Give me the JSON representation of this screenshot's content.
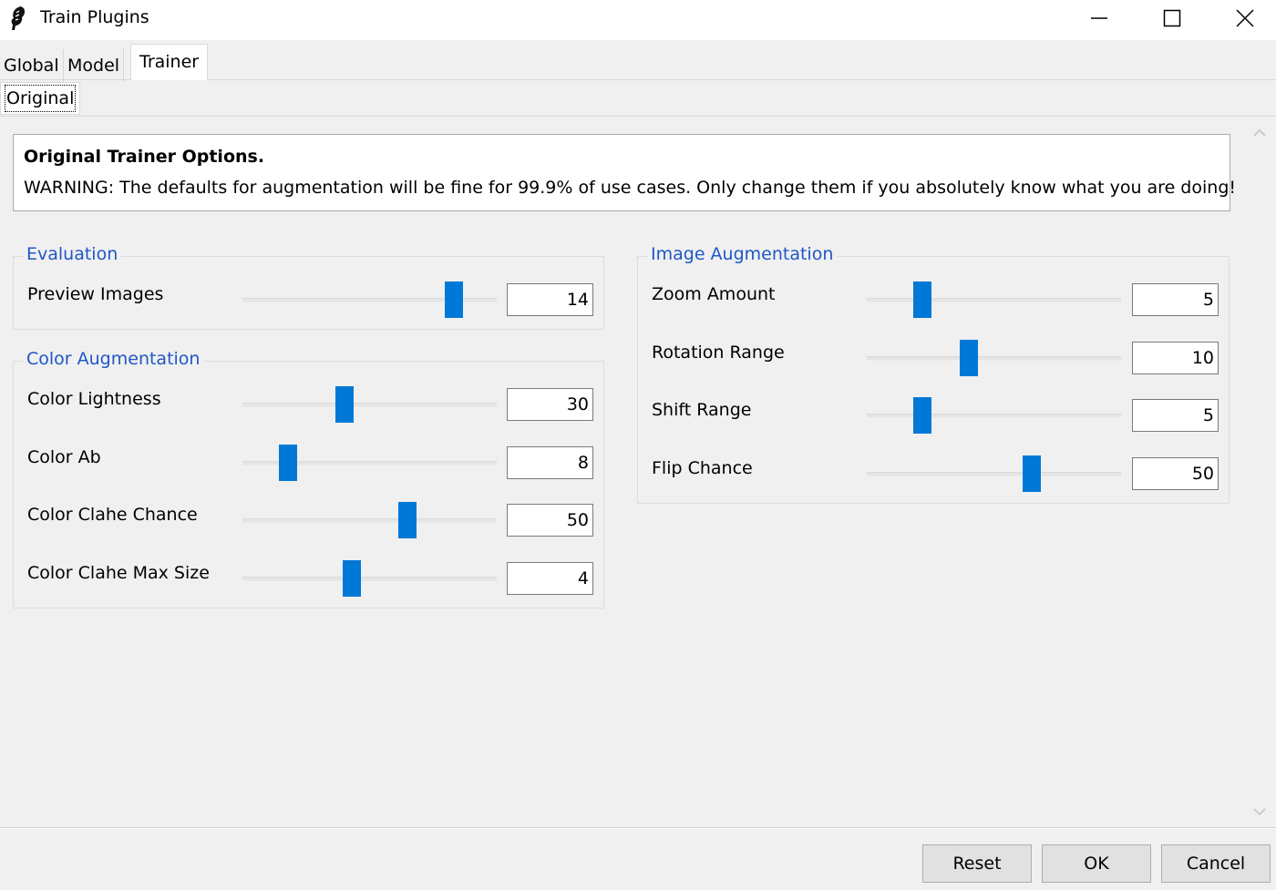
{
  "window": {
    "title": "Train Plugins",
    "icon": "feather-icon"
  },
  "tabs": [
    {
      "label": "Global",
      "active": false
    },
    {
      "label": "Model",
      "active": false
    },
    {
      "label": "Trainer",
      "active": true
    }
  ],
  "subtabs": [
    {
      "label": "Original",
      "active": true
    }
  ],
  "info": {
    "title": "Original Trainer Options.",
    "text": "WARNING: The defaults for augmentation will be fine for 99.9% of use cases. Only change them if you absolutely know what you are doing!"
  },
  "groups": {
    "evaluation": {
      "title": "Evaluation",
      "options": [
        {
          "label": "Preview Images",
          "value": "14",
          "slider_fraction": 0.83
        }
      ]
    },
    "color_augmentation": {
      "title": "Color Augmentation",
      "options": [
        {
          "label": "Color Lightness",
          "value": "30",
          "slider_fraction": 0.4
        },
        {
          "label": "Color Ab",
          "value": "8",
          "slider_fraction": 0.18
        },
        {
          "label": "Color Clahe Chance",
          "value": "50",
          "slider_fraction": 0.65
        },
        {
          "label": "Color Clahe Max Size",
          "value": "4",
          "slider_fraction": 0.43
        }
      ]
    },
    "image_augmentation": {
      "title": "Image Augmentation",
      "options": [
        {
          "label": "Zoom Amount",
          "value": "5",
          "slider_fraction": 0.22
        },
        {
          "label": "Rotation Range",
          "value": "10",
          "slider_fraction": 0.4
        },
        {
          "label": "Shift Range",
          "value": "5",
          "slider_fraction": 0.22
        },
        {
          "label": "Flip Chance",
          "value": "50",
          "slider_fraction": 0.65
        }
      ]
    }
  },
  "buttons": {
    "reset": "Reset",
    "ok": "OK",
    "cancel": "Cancel"
  },
  "colors": {
    "accent": "#0078d7",
    "group_title": "#1f56c7"
  }
}
